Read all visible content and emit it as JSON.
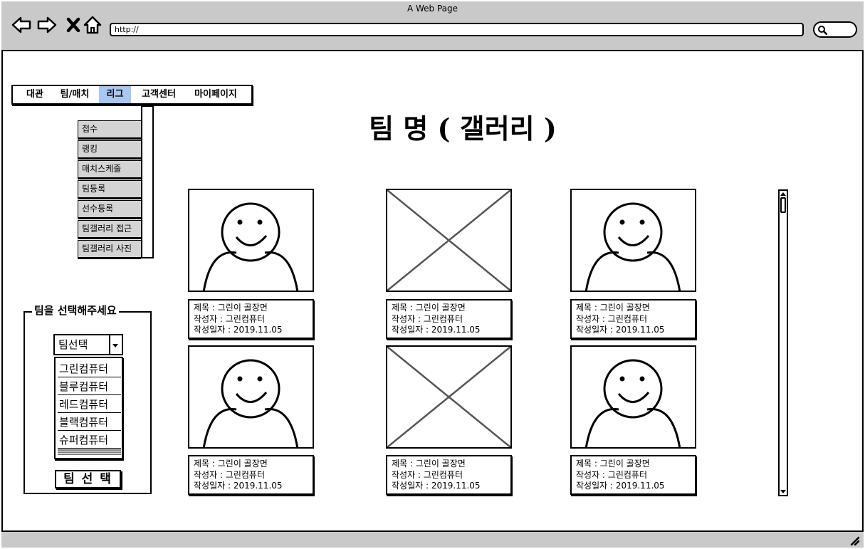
{
  "window": {
    "title": "A Web Page"
  },
  "browser": {
    "url": "http://"
  },
  "menu": [
    {
      "label": "대관"
    },
    {
      "label": "팀/매치"
    },
    {
      "label": "리그"
    },
    {
      "label": "고객센터"
    },
    {
      "label": "마이페이지"
    }
  ],
  "submenu": [
    {
      "label": "접수"
    },
    {
      "label": "랭킹"
    },
    {
      "label": "매치스케줄"
    },
    {
      "label": "팀등록"
    },
    {
      "label": "선수등록"
    },
    {
      "label": "팀갤러리 접근"
    },
    {
      "label": "팀갤러리 사진"
    }
  ],
  "page": {
    "title": "팀 명 ( 갤러리 )"
  },
  "team_select": {
    "legend": "팀을 선택해주세요",
    "combo_value": "팀선택",
    "options": [
      "그린컴퓨터",
      "블루컴퓨터",
      "레드컴퓨터",
      "블랙컴퓨터",
      "슈퍼컴퓨터"
    ],
    "button_label": "팀 선 택"
  },
  "gallery": [
    {
      "image": "person-placeholder",
      "title_line": "제목 : 그린이 골장면",
      "author_line": "작성자 : 그린컴퓨터",
      "date_line": "작성일자 : 2019.11.05"
    },
    {
      "image": "image-placeholder",
      "title_line": "제목 : 그린이 골장면",
      "author_line": "작성자 : 그린컴퓨터",
      "date_line": "작성일자 : 2019.11.05"
    },
    {
      "image": "person-placeholder",
      "title_line": "제목 : 그린이 골장면",
      "author_line": "작성자 : 그린컴퓨터",
      "date_line": "작성일자 : 2019.11.05"
    },
    {
      "image": "person-placeholder",
      "title_line": "제목 : 그린이 골장면",
      "author_line": "작성자 : 그린컴퓨터",
      "date_line": "작성일자 : 2019.11.05"
    },
    {
      "image": "image-placeholder",
      "title_line": "제목 : 그린이 골장면",
      "author_line": "작성자 : 그린컴퓨터",
      "date_line": "작성일자 : 2019.11.05"
    },
    {
      "image": "person-placeholder",
      "title_line": "제목 : 그린이 골장면",
      "author_line": "작성자 : 그린컴퓨터",
      "date_line": "작성일자 : 2019.11.05"
    }
  ],
  "colors": {
    "chrome": "#c9c9c9",
    "menu_active": "#a9c7f0",
    "submenu_bg": "#d4d4d4"
  }
}
